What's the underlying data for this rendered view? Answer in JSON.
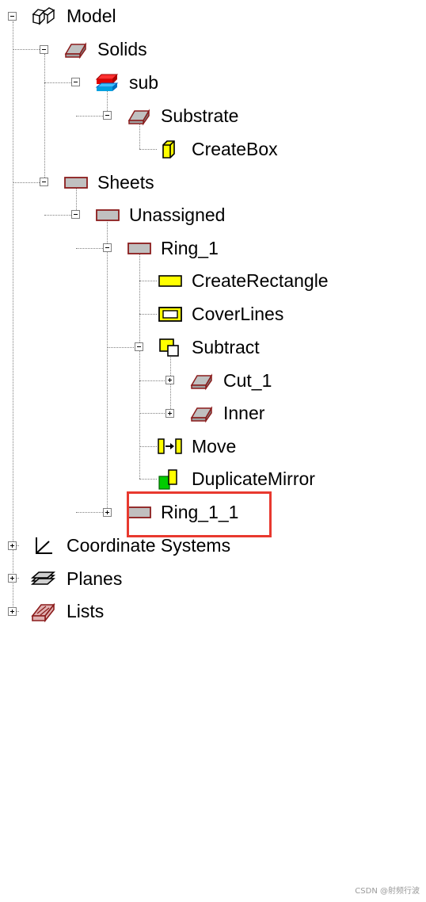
{
  "tree": {
    "nodes": [
      {
        "id": "model",
        "label": "Model",
        "icon": "model-icon",
        "expanded": true
      },
      {
        "id": "solids",
        "label": "Solids",
        "icon": "solid-box-icon",
        "expanded": true
      },
      {
        "id": "sub",
        "label": "sub",
        "icon": "material-layers-icon",
        "expanded": true
      },
      {
        "id": "substrate",
        "label": "Substrate",
        "icon": "solid-box-icon",
        "expanded": true
      },
      {
        "id": "createbox",
        "label": "CreateBox",
        "icon": "create-box-icon"
      },
      {
        "id": "sheets",
        "label": "Sheets",
        "icon": "sheet-icon",
        "expanded": true
      },
      {
        "id": "unassigned",
        "label": "Unassigned",
        "icon": "sheet-icon",
        "expanded": true
      },
      {
        "id": "ring1",
        "label": "Ring_1",
        "icon": "sheet-icon",
        "expanded": true
      },
      {
        "id": "createrectangle",
        "label": "CreateRectangle",
        "icon": "rectangle-icon"
      },
      {
        "id": "coverlines",
        "label": "CoverLines",
        "icon": "cover-lines-icon"
      },
      {
        "id": "subtract",
        "label": "Subtract",
        "icon": "subtract-icon",
        "expanded": true
      },
      {
        "id": "cut1",
        "label": "Cut_1",
        "icon": "solid-box-icon",
        "expanded": false
      },
      {
        "id": "inner",
        "label": "Inner",
        "icon": "solid-box-icon",
        "expanded": false
      },
      {
        "id": "move",
        "label": "Move",
        "icon": "move-icon"
      },
      {
        "id": "duplicatemirror",
        "label": "DuplicateMirror",
        "icon": "duplicate-mirror-icon"
      },
      {
        "id": "ring11",
        "label": "Ring_1_1",
        "icon": "sheet-icon",
        "expanded": false,
        "highlighted": true
      },
      {
        "id": "coordsys",
        "label": "Coordinate Systems",
        "icon": "coordinate-axes-icon",
        "expanded": false
      },
      {
        "id": "planes",
        "label": "Planes",
        "icon": "planes-icon",
        "expanded": false
      },
      {
        "id": "lists",
        "label": "Lists",
        "icon": "lists-icon",
        "expanded": false
      }
    ]
  },
  "colors": {
    "highlight_border": "#e8392f",
    "sheet_fill": "#c0c0c0",
    "sheet_border": "#8b1c1c",
    "yellow": "#ffff00",
    "green": "#00cc00"
  },
  "watermark": "CSDN @射频行波"
}
